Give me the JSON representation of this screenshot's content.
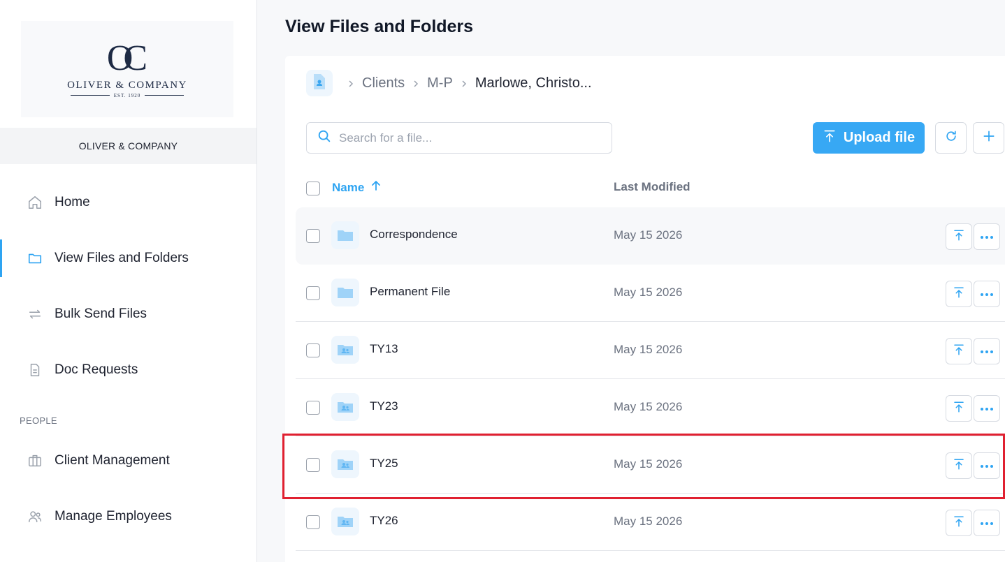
{
  "brand": {
    "logo_mark": "OC",
    "logo_name": "OLIVER & COMPANY",
    "logo_est": "EST. 1920",
    "company_label": "OLIVER & COMPANY"
  },
  "nav": {
    "items": [
      {
        "label": "Home",
        "icon": "home-icon"
      },
      {
        "label": "View Files and Folders",
        "icon": "folder-icon"
      },
      {
        "label": "Bulk Send Files",
        "icon": "repeat-icon"
      },
      {
        "label": "Doc Requests",
        "icon": "document-icon"
      }
    ],
    "section_people": "PEOPLE",
    "people_items": [
      {
        "label": "Client Management",
        "icon": "briefcase-icon"
      },
      {
        "label": "Manage Employees",
        "icon": "users-icon"
      }
    ]
  },
  "page": {
    "title": "View Files and Folders"
  },
  "breadcrumb": {
    "items": [
      "Clients",
      "M-P"
    ],
    "current": "Marlowe, Christo..."
  },
  "search": {
    "placeholder": "Search for a file...",
    "value": ""
  },
  "toolbar": {
    "upload_label": "Upload file"
  },
  "table": {
    "col_name": "Name",
    "col_modified": "Last Modified",
    "rows": [
      {
        "name": "Correspondence",
        "modified": "May 15 2026",
        "icon": "folder-icon"
      },
      {
        "name": "Permanent File",
        "modified": "May 15 2026",
        "icon": "folder-icon"
      },
      {
        "name": "TY13",
        "modified": "May 15 2026",
        "icon": "shared-folder-icon"
      },
      {
        "name": "TY23",
        "modified": "May 15 2026",
        "icon": "shared-folder-icon"
      },
      {
        "name": "TY25",
        "modified": "May 15 2026",
        "icon": "shared-folder-icon"
      },
      {
        "name": "TY26",
        "modified": "May 15 2026",
        "icon": "shared-folder-icon"
      }
    ]
  },
  "colors": {
    "accent": "#37a8f4",
    "highlight": "#e02030"
  }
}
